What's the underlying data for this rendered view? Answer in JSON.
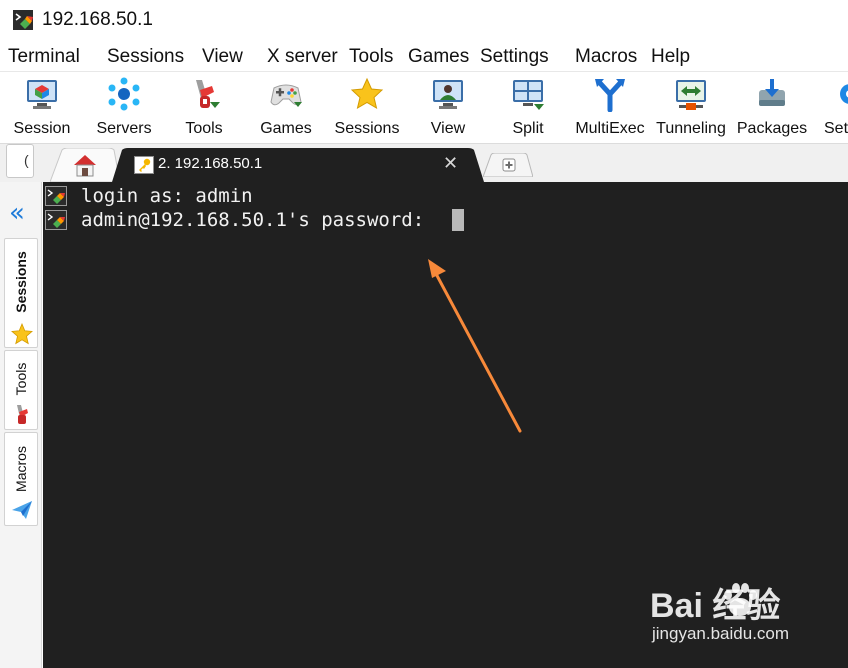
{
  "window": {
    "title": "192.168.50.1"
  },
  "menu": {
    "items": [
      "Terminal",
      "Sessions",
      "View",
      "X server",
      "Tools",
      "Games",
      "Settings",
      "Macros",
      "Help"
    ]
  },
  "toolbar": {
    "items": [
      {
        "label": "Session",
        "icon": "session-icon"
      },
      {
        "label": "Servers",
        "icon": "servers-icon"
      },
      {
        "label": "Tools",
        "icon": "tools-icon"
      },
      {
        "label": "Games",
        "icon": "gamepad-icon"
      },
      {
        "label": "Sessions",
        "icon": "star-icon"
      },
      {
        "label": "View",
        "icon": "view-icon"
      },
      {
        "label": "Split",
        "icon": "split-icon"
      },
      {
        "label": "MultiExec",
        "icon": "multiexec-icon"
      },
      {
        "label": "Tunneling",
        "icon": "tunneling-icon"
      },
      {
        "label": "Packages",
        "icon": "packages-icon"
      },
      {
        "label": "Sett",
        "icon": "settings-icon"
      }
    ]
  },
  "tabs": {
    "quick_connect_glyph": "(",
    "home_icon": "home-icon",
    "active": {
      "label": "2. 192.168.50.1",
      "close_glyph": "✕"
    },
    "new_tab_icon": "new-tab-icon"
  },
  "sidebar": {
    "collapse_glyph": "«",
    "tabs": [
      {
        "label": "Sessions",
        "icon": "star-icon"
      },
      {
        "label": "Tools",
        "icon": "tools-icon"
      },
      {
        "label": "Macros",
        "icon": "paper-plane-icon"
      }
    ]
  },
  "terminal": {
    "lines": [
      "login as: admin",
      "admin@192.168.50.1's password: "
    ]
  },
  "annotation": {
    "arrow_color": "#f7893a"
  },
  "watermark": {
    "brand": "Bai  经验",
    "sub": "jingyan.baidu.com"
  },
  "colors": {
    "terminal_bg": "#202020",
    "terminal_fg": "#f2f2f2",
    "accent": "#1e7bd9"
  }
}
